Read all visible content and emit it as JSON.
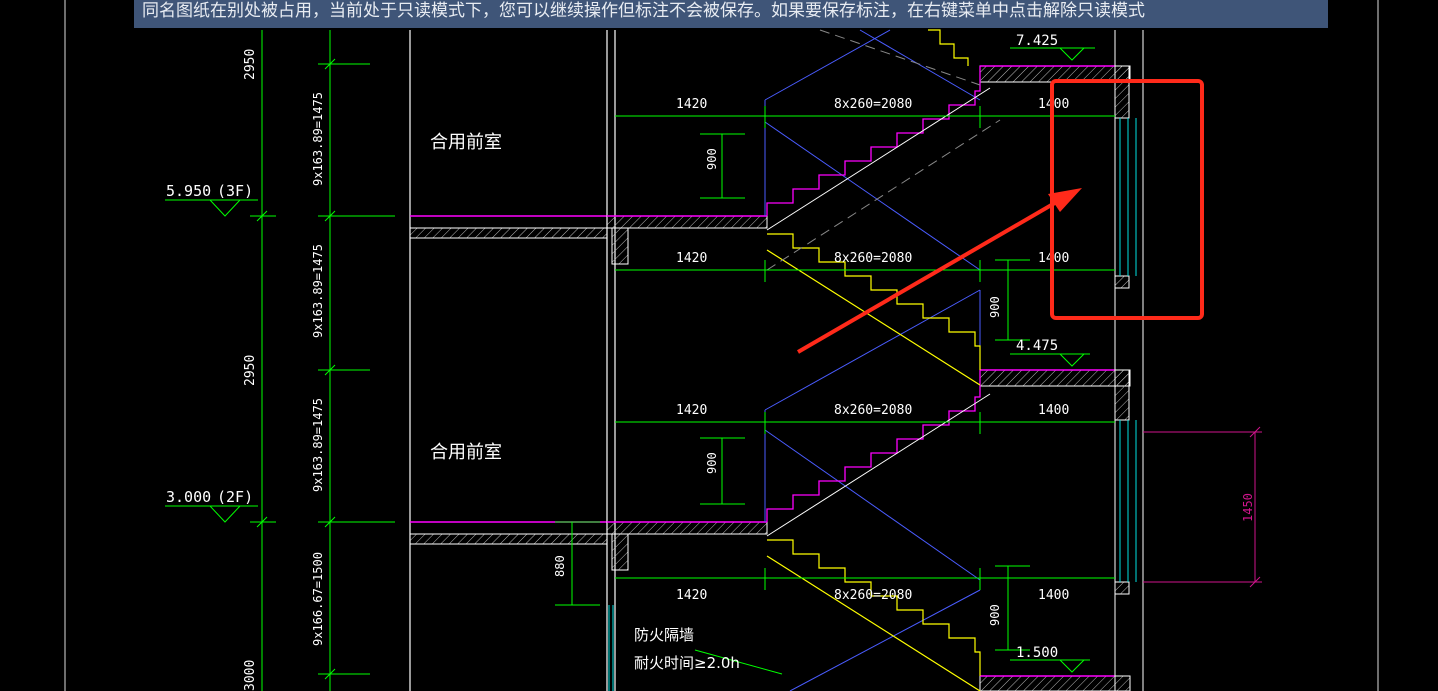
{
  "banner": {
    "message": "同名图纸在别处被占用，当前处于只读模式下，您可以继续操作但标注不会被保存。如果要保存标注，在右键菜单中点击解除只读模式"
  },
  "colors": {
    "background": "#000000",
    "banner_bg": "#3f5578",
    "dimension_green": "#00ff00",
    "stair_yellow": "#ffff00",
    "wall_magenta": "#ff00ff",
    "guide_blue": "#4a5cff",
    "hatch_white": "#ffffff",
    "dim_pink": "#d0148c",
    "markup_red": "#ff2a1a",
    "glass_cyan": "#00e0e0"
  },
  "drawing": {
    "rooms": [
      "合用前室",
      "合用前室"
    ],
    "levels": [
      {
        "value": "5.950",
        "floor": "(3F)"
      },
      {
        "value": "3.000",
        "floor": "(2F)"
      }
    ],
    "landing_elevations": [
      "7.425",
      "4.475",
      "1.500"
    ],
    "storey_heights": [
      "2950",
      "2950",
      "3000"
    ],
    "riser_dims": [
      "9x163.89=1475",
      "9x163.89=1475",
      "9x163.89=1475",
      "9x166.67=1500"
    ],
    "landing_widths_left": [
      "1420",
      "1420",
      "1420",
      "1420"
    ],
    "flight_lengths": [
      "8x260=2080",
      "8x260=2080",
      "8x260=2080",
      "8x260=2080"
    ],
    "landing_widths_right": [
      "1400",
      "1400",
      "1400",
      "1400"
    ],
    "rail_heights_left": [
      "900",
      "900"
    ],
    "rail_heights_right": [
      "900",
      "900"
    ],
    "sill_height": "880",
    "window_height": "1450",
    "firewall_note": [
      "防火隔墙",
      "耐火时间≥2.0h"
    ]
  }
}
